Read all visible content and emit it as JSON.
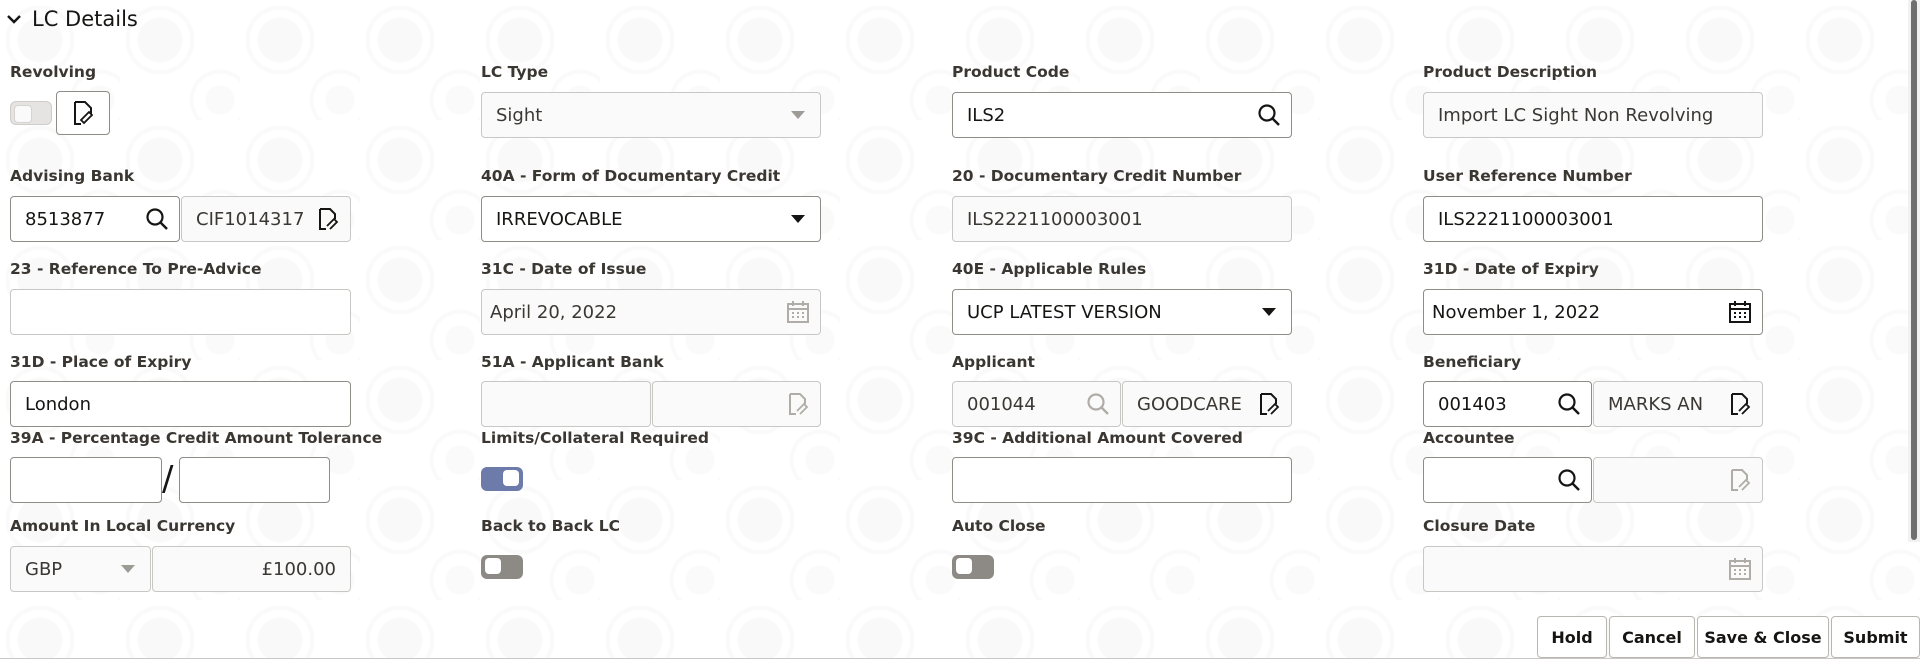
{
  "section": {
    "title": "LC Details"
  },
  "fields": {
    "revolving": {
      "label": "Revolving"
    },
    "lc_type": {
      "label": "LC Type",
      "value": "Sight"
    },
    "product_code": {
      "label": "Product Code",
      "value": "ILS2"
    },
    "product_description": {
      "label": "Product Description",
      "value": "Import LC Sight Non Revolving"
    },
    "advising_bank": {
      "label": "Advising Bank",
      "value": "8513877",
      "customer_id": "CIF1014317"
    },
    "form_of_credit": {
      "label": "40A - Form of Documentary Credit",
      "value": "IRREVOCABLE"
    },
    "documentary_credit_number": {
      "label": "20 - Documentary Credit Number",
      "value": "ILS2221100003001"
    },
    "user_reference_number": {
      "label": "User Reference Number",
      "value": "ILS2221100003001"
    },
    "reference_pre_advice": {
      "label": "23 - Reference To Pre-Advice",
      "value": ""
    },
    "date_of_issue": {
      "label": "31C - Date of Issue",
      "value": "April 20, 2022"
    },
    "applicable_rules": {
      "label": "40E - Applicable Rules",
      "value": "UCP LATEST VERSION"
    },
    "date_of_expiry": {
      "label": "31D - Date of Expiry",
      "value": "November 1, 2022"
    },
    "place_of_expiry": {
      "label": "31D - Place of Expiry",
      "value": "London"
    },
    "applicant_bank": {
      "label": "51A - Applicant Bank",
      "value": "",
      "name": ""
    },
    "applicant": {
      "label": "Applicant",
      "value": "001044",
      "name": "GOODCARE"
    },
    "beneficiary": {
      "label": "Beneficiary",
      "value": "001403",
      "name": "MARKS AN"
    },
    "pct_tolerance": {
      "label": "39A - Percentage Credit Amount Tolerance",
      "separator": "/",
      "plus": "",
      "minus": ""
    },
    "limits_required": {
      "label": "Limits/Collateral Required"
    },
    "additional_amount": {
      "label": "39C - Additional Amount Covered",
      "value": ""
    },
    "accountee": {
      "label": "Accountee",
      "value": "",
      "name": ""
    },
    "amount_local_currency": {
      "label": "Amount In Local Currency",
      "currency": "GBP",
      "amount": "£100.00"
    },
    "back_to_back": {
      "label": "Back to Back LC"
    },
    "auto_close": {
      "label": "Auto Close"
    },
    "closure_date": {
      "label": "Closure Date",
      "value": ""
    }
  },
  "toggles": {
    "revolving": "off-disabled",
    "limits_required": "on",
    "back_to_back": "off",
    "auto_close": "off"
  },
  "actions": {
    "hold": "Hold",
    "cancel": "Cancel",
    "save_close": "Save & Close",
    "submit": "Submit"
  },
  "colors": {
    "toggle_on": "#6d7bab",
    "toggle_off": "#8d8a85",
    "border": "#8f8c88"
  }
}
